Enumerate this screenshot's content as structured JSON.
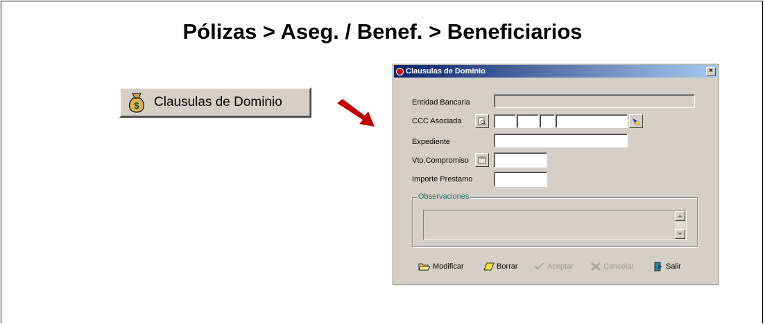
{
  "page": {
    "title": "Pólizas > Aseg. / Benef. > Beneficiarios"
  },
  "launcher": {
    "label": "Clausulas de Dominio",
    "icon": "money-bag-icon"
  },
  "dialog": {
    "title": "Clausulas de Dominio",
    "close_symbol": "×",
    "fields": {
      "entidad_label": "Entidad Bancaria",
      "entidad_value": "",
      "ccc_label": "CCC Asociada",
      "ccc_parts": [
        "",
        "",
        "",
        ""
      ],
      "expediente_label": "Expediente",
      "expediente_value": "",
      "vto_label": "Vto.Compromiso",
      "vto_value": "",
      "importe_label": "Importe Prestamo",
      "importe_value": ""
    },
    "observaciones": {
      "legend": "Observaciones",
      "value": ""
    },
    "toolbar": {
      "modificar": "Modificar",
      "borrar": "Borrar",
      "aceptar": "Aceptar",
      "cancelar": "Cancelar",
      "salir": "Salir"
    }
  },
  "colors": {
    "window_bg": "#d4d0c8",
    "title_start": "#0a246a",
    "title_end": "#a6caf0",
    "arrow": "#c00000"
  }
}
